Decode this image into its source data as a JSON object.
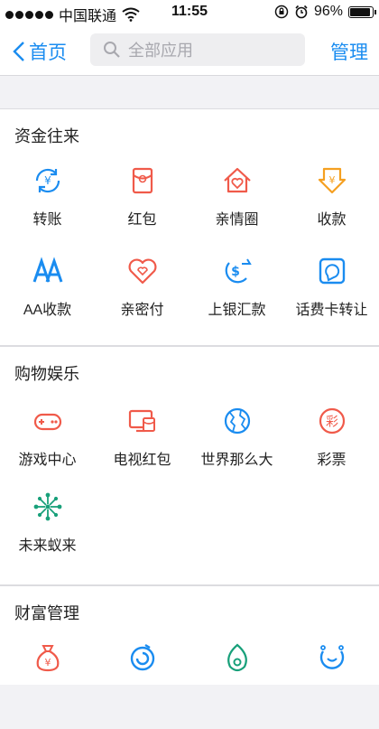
{
  "status": {
    "carrier": "中国联通",
    "time": "11:55",
    "battery": "96%",
    "battery_level": 0.96
  },
  "nav": {
    "back_label": "首页",
    "search_placeholder": "全部应用",
    "manage_label": "管理"
  },
  "sections": [
    {
      "title": "资金往来",
      "items": [
        {
          "label": "转账",
          "icon": "transfer-icon",
          "color": "#1a8cf0"
        },
        {
          "label": "红包",
          "icon": "red-envelope-icon",
          "color": "#f05a4a"
        },
        {
          "label": "亲情圈",
          "icon": "family-house-icon",
          "color": "#f05a4a"
        },
        {
          "label": "收款",
          "icon": "receive-money-icon",
          "color": "#f5a021"
        },
        {
          "label": "AA收款",
          "icon": "aa-icon",
          "color": "#1a8cf0"
        },
        {
          "label": "亲密付",
          "icon": "intimate-pay-icon",
          "color": "#f05a4a"
        },
        {
          "label": "上银汇款",
          "icon": "remittance-icon",
          "color": "#1a8cf0"
        },
        {
          "label": "话费卡转让",
          "icon": "phone-card-icon",
          "color": "#1a8cf0"
        }
      ]
    },
    {
      "title": "购物娱乐",
      "items": [
        {
          "label": "游戏中心",
          "icon": "gamepad-icon",
          "color": "#f05a4a"
        },
        {
          "label": "电视红包",
          "icon": "tv-envelope-icon",
          "color": "#f05a4a"
        },
        {
          "label": "世界那么大",
          "icon": "globe-icon",
          "color": "#1a8cf0"
        },
        {
          "label": "彩票",
          "icon": "lottery-icon",
          "color": "#f05a4a"
        },
        {
          "label": "未来蚁来",
          "icon": "burst-icon",
          "color": "#18a07a"
        }
      ]
    },
    {
      "title": "财富管理",
      "items": [
        {
          "label": "",
          "icon": "money-bag-icon",
          "color": "#f05a4a"
        },
        {
          "label": "",
          "icon": "swirl-icon",
          "color": "#1a8cf0"
        },
        {
          "label": "",
          "icon": "leaf-icon",
          "color": "#18a07a"
        },
        {
          "label": "",
          "icon": "smile-icon",
          "color": "#1a8cf0"
        }
      ]
    }
  ]
}
